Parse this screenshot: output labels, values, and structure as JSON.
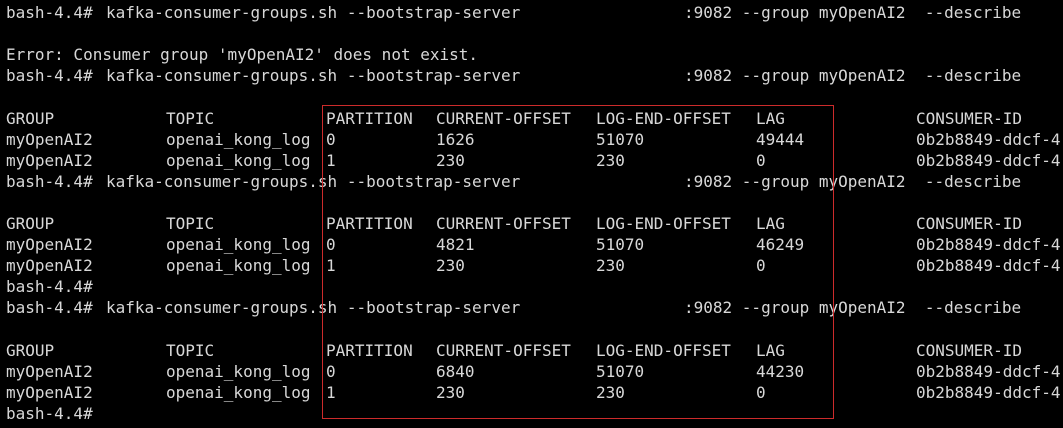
{
  "terminal": {
    "lines": [
      {
        "type": "cmd",
        "prompt": "bash-4.4#",
        "command": "kafka-consumer-groups.sh --bootstrap-server",
        "tail": ":9082 --group myOpenAI2  --describe"
      },
      {
        "type": "blank"
      },
      {
        "type": "text",
        "text": "Error: Consumer group 'myOpenAI2' does not exist."
      },
      {
        "type": "cmd",
        "prompt": "bash-4.4#",
        "command": "kafka-consumer-groups.sh --bootstrap-server",
        "tail": ":9082 --group myOpenAI2  --describe"
      },
      {
        "type": "blank"
      },
      {
        "type": "row",
        "cells": [
          "GROUP",
          "TOPIC",
          "PARTITION",
          "CURRENT-OFFSET",
          "LOG-END-OFFSET",
          "LAG",
          "CONSUMER-ID"
        ]
      },
      {
        "type": "row",
        "cells": [
          "myOpenAI2",
          "openai_kong_log",
          "0",
          "1626",
          "51070",
          "49444",
          "0b2b8849-ddcf-4"
        ]
      },
      {
        "type": "row",
        "cells": [
          "myOpenAI2",
          "openai_kong_log",
          "1",
          "230",
          "230",
          "0",
          "0b2b8849-ddcf-4"
        ]
      },
      {
        "type": "cmd",
        "prompt": "bash-4.4#",
        "command": "kafka-consumer-groups.sh --bootstrap-server",
        "tail": ":9082 --group myOpenAI2  --describe"
      },
      {
        "type": "blank"
      },
      {
        "type": "row",
        "cells": [
          "GROUP",
          "TOPIC",
          "PARTITION",
          "CURRENT-OFFSET",
          "LOG-END-OFFSET",
          "LAG",
          "CONSUMER-ID"
        ]
      },
      {
        "type": "row",
        "cells": [
          "myOpenAI2",
          "openai_kong_log",
          "0",
          "4821",
          "51070",
          "46249",
          "0b2b8849-ddcf-4"
        ]
      },
      {
        "type": "row",
        "cells": [
          "myOpenAI2",
          "openai_kong_log",
          "1",
          "230",
          "230",
          "0",
          "0b2b8849-ddcf-4"
        ]
      },
      {
        "type": "text",
        "text": "bash-4.4#"
      },
      {
        "type": "cmd",
        "prompt": "bash-4.4#",
        "command": "kafka-consumer-groups.sh --bootstrap-server",
        "tail": ":9082 --group myOpenAI2  --describe"
      },
      {
        "type": "blank"
      },
      {
        "type": "row",
        "cells": [
          "GROUP",
          "TOPIC",
          "PARTITION",
          "CURRENT-OFFSET",
          "LOG-END-OFFSET",
          "LAG",
          "CONSUMER-ID"
        ]
      },
      {
        "type": "row",
        "cells": [
          "myOpenAI2",
          "openai_kong_log",
          "0",
          "6840",
          "51070",
          "44230",
          "0b2b8849-ddcf-4"
        ]
      },
      {
        "type": "row",
        "cells": [
          "myOpenAI2",
          "openai_kong_log",
          "1",
          "230",
          "230",
          "0",
          "0b2b8849-ddcf-4"
        ]
      },
      {
        "type": "text",
        "text": "bash-4.4#"
      }
    ]
  },
  "colors": {
    "background": "#000000",
    "text": "#d8d8d8",
    "highlight_border": "#cc2b2b"
  }
}
